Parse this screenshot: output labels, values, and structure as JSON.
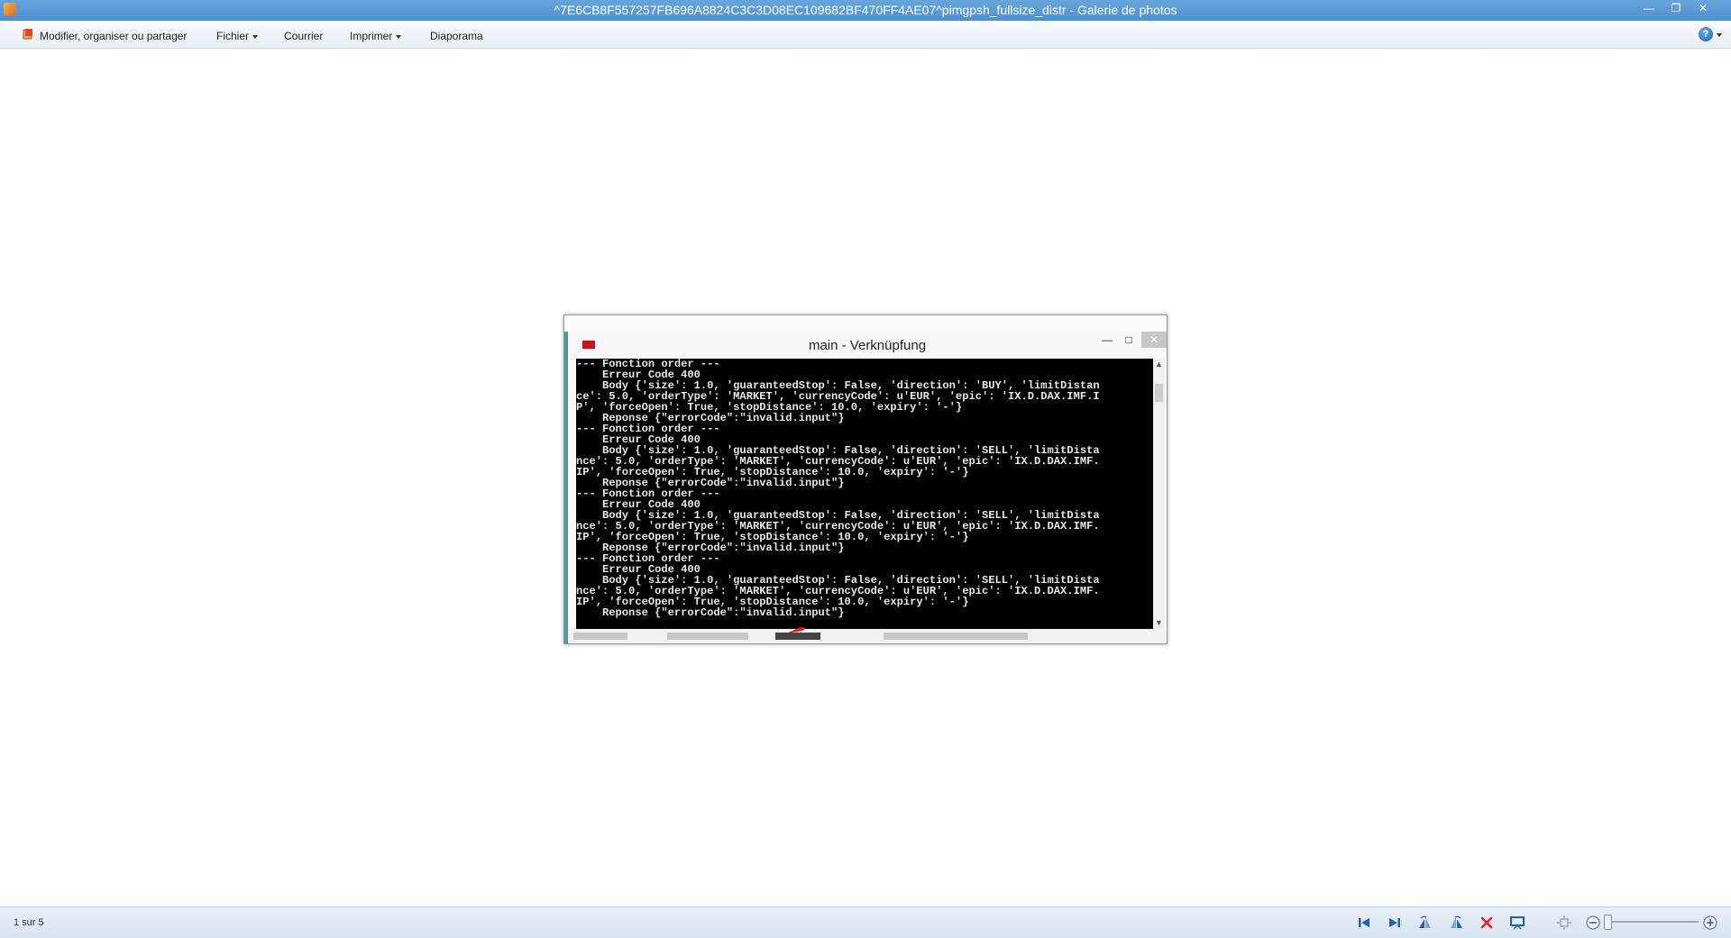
{
  "window": {
    "title": "^7E6CB8F557257FB696A8824C3C3D08EC109682BF470FF4AE07^pimgpsh_fullsize_distr - Galerie de photos",
    "controls": [
      "minimize-icon",
      "restore-icon",
      "close-icon"
    ]
  },
  "toolbar": {
    "organize_label": "Modifier, organiser ou partager",
    "file_label": "Fichier",
    "mail_label": "Courrier",
    "print_label": "Imprimer",
    "slideshow_label": "Diaporama",
    "help_label": "?"
  },
  "photo": {
    "console_title": "main - Verknüpfung",
    "console_lines": [
      "--- Fonction order ---",
      "    Erreur Code 400",
      "    Body {'size': 1.0, 'guaranteedStop': False, 'direction': 'BUY', 'limitDistan",
      "ce': 5.0, 'orderType': 'MARKET', 'currencyCode': u'EUR', 'epic': 'IX.D.DAX.IMF.I",
      "P', 'forceOpen': True, 'stopDistance': 10.0, 'expiry': '-'}",
      "    Reponse {\"errorCode\":\"invalid.input\"}",
      "--- Fonction order ---",
      "    Erreur Code 400",
      "    Body {'size': 1.0, 'guaranteedStop': False, 'direction': 'SELL', 'limitDista",
      "nce': 5.0, 'orderType': 'MARKET', 'currencyCode': u'EUR', 'epic': 'IX.D.DAX.IMF.",
      "IP', 'forceOpen': True, 'stopDistance': 10.0, 'expiry': '-'}",
      "    Reponse {\"errorCode\":\"invalid.input\"}",
      "--- Fonction order ---",
      "    Erreur Code 400",
      "    Body {'size': 1.0, 'guaranteedStop': False, 'direction': 'SELL', 'limitDista",
      "nce': 5.0, 'orderType': 'MARKET', 'currencyCode': u'EUR', 'epic': 'IX.D.DAX.IMF.",
      "IP', 'forceOpen': True, 'stopDistance': 10.0, 'expiry': '-'}",
      "    Reponse {\"errorCode\":\"invalid.input\"}",
      "--- Fonction order ---",
      "    Erreur Code 400",
      "    Body {'size': 1.0, 'guaranteedStop': False, 'direction': 'SELL', 'limitDista",
      "nce': 5.0, 'orderType': 'MARKET', 'currencyCode': u'EUR', 'epic': 'IX.D.DAX.IMF.",
      "IP', 'forceOpen': True, 'stopDistance': 10.0, 'expiry': '-'}",
      "    Reponse {\"errorCode\":\"invalid.input\"}"
    ]
  },
  "status": {
    "position_text": "1 sur 5"
  },
  "navigation": {
    "buttons": [
      "first-icon",
      "next-icon",
      "rotate-left-icon",
      "rotate-right-icon",
      "delete-icon",
      "slideshow-icon",
      "actual-size-icon",
      "zoom-out-icon",
      "zoom-in-icon"
    ]
  },
  "colors": {
    "titlebar": "#5b9bd5",
    "console_bg": "#000000",
    "console_fg": "#e8e8e8",
    "nav_icon_blue": "#1f5fb8",
    "delete_red": "#d9262d"
  }
}
